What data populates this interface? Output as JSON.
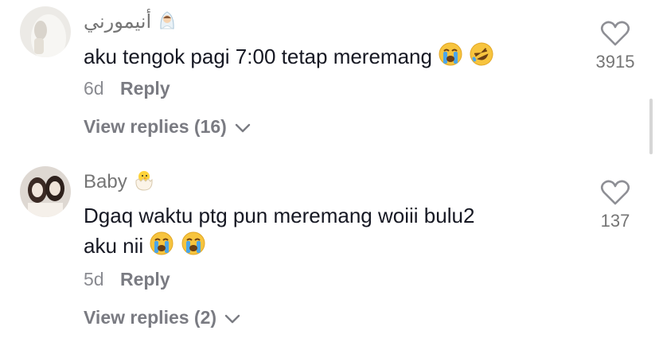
{
  "comments": [
    {
      "username": "أنيمورني",
      "text": "aku tengok pagi 7:00 tetap meremang",
      "time": "6d",
      "reply_label": "Reply",
      "view_replies": "View replies (16)",
      "likes": "3915"
    },
    {
      "username": "Baby",
      "text_line1": "Dgaq waktu ptg pun meremang woiii bulu2",
      "text_line2": "aku nii",
      "time": "5d",
      "reply_label": "Reply",
      "view_replies": "View replies (2)",
      "likes": "137"
    }
  ]
}
